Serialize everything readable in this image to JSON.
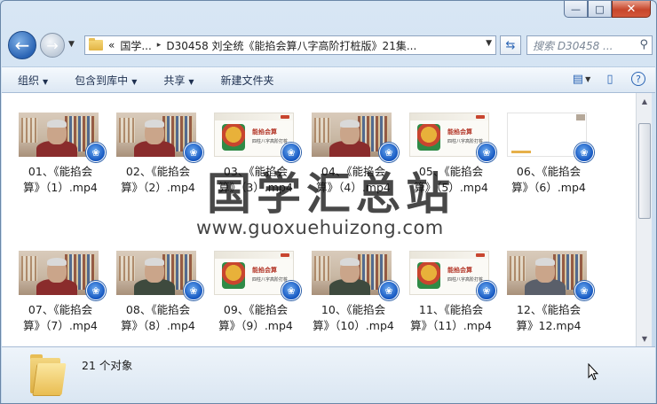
{
  "window": {
    "minimize": "—",
    "maximize": "□",
    "close": "✕"
  },
  "address": {
    "chevron": "«",
    "crumbs": [
      "国学...",
      "D30458 刘全统《能掐会算八字高阶打桩版》21集..."
    ],
    "sep": "▸",
    "dropdown": "▼"
  },
  "search": {
    "placeholder": "搜索 D30458 ..."
  },
  "toolbar": {
    "organize": "组织",
    "include_in_library": "包含到库中",
    "share": "共享",
    "new_folder": "新建文件夹",
    "arrow": "▼"
  },
  "files": [
    {
      "line1": "01、《能掐会",
      "line2": "算》（1）.mp4"
    },
    {
      "line1": "02、《能掐会",
      "line2": "算》（2）.mp4"
    },
    {
      "line1": "03、《能掐会",
      "line2": "算》（3）.mp4"
    },
    {
      "line1": "04、《能掐会",
      "line2": "算》（4）.mp4"
    },
    {
      "line1": "05、《能掐会",
      "line2": "算》（5）.mp4"
    },
    {
      "line1": "06、《能掐会",
      "line2": "算》（6）.mp4"
    },
    {
      "line1": "07、《能掐会",
      "line2": "算》（7）.mp4"
    },
    {
      "line1": "08、《能掐会",
      "line2": "算》（8）.mp4"
    },
    {
      "line1": "09、《能掐会",
      "line2": "算》（9）.mp4"
    },
    {
      "line1": "10、《能掐会",
      "line2": "算》（10）.mp4"
    },
    {
      "line1": "11、《能掐会",
      "line2": "算》（11）.mp4"
    },
    {
      "line1": "12、《能掐会",
      "line2": "算》12.mp4"
    }
  ],
  "slide": {
    "title": "能掐会算",
    "subtitle": "四柱八字高阶打桩"
  },
  "watermark": {
    "big": "国学汇总站",
    "url": "www.guoxuehuizong.com"
  },
  "status": {
    "count": "21 个对象"
  },
  "colors": {
    "accent": "#2a64b4",
    "close": "#c7472c",
    "folder": "#e9bd52"
  }
}
